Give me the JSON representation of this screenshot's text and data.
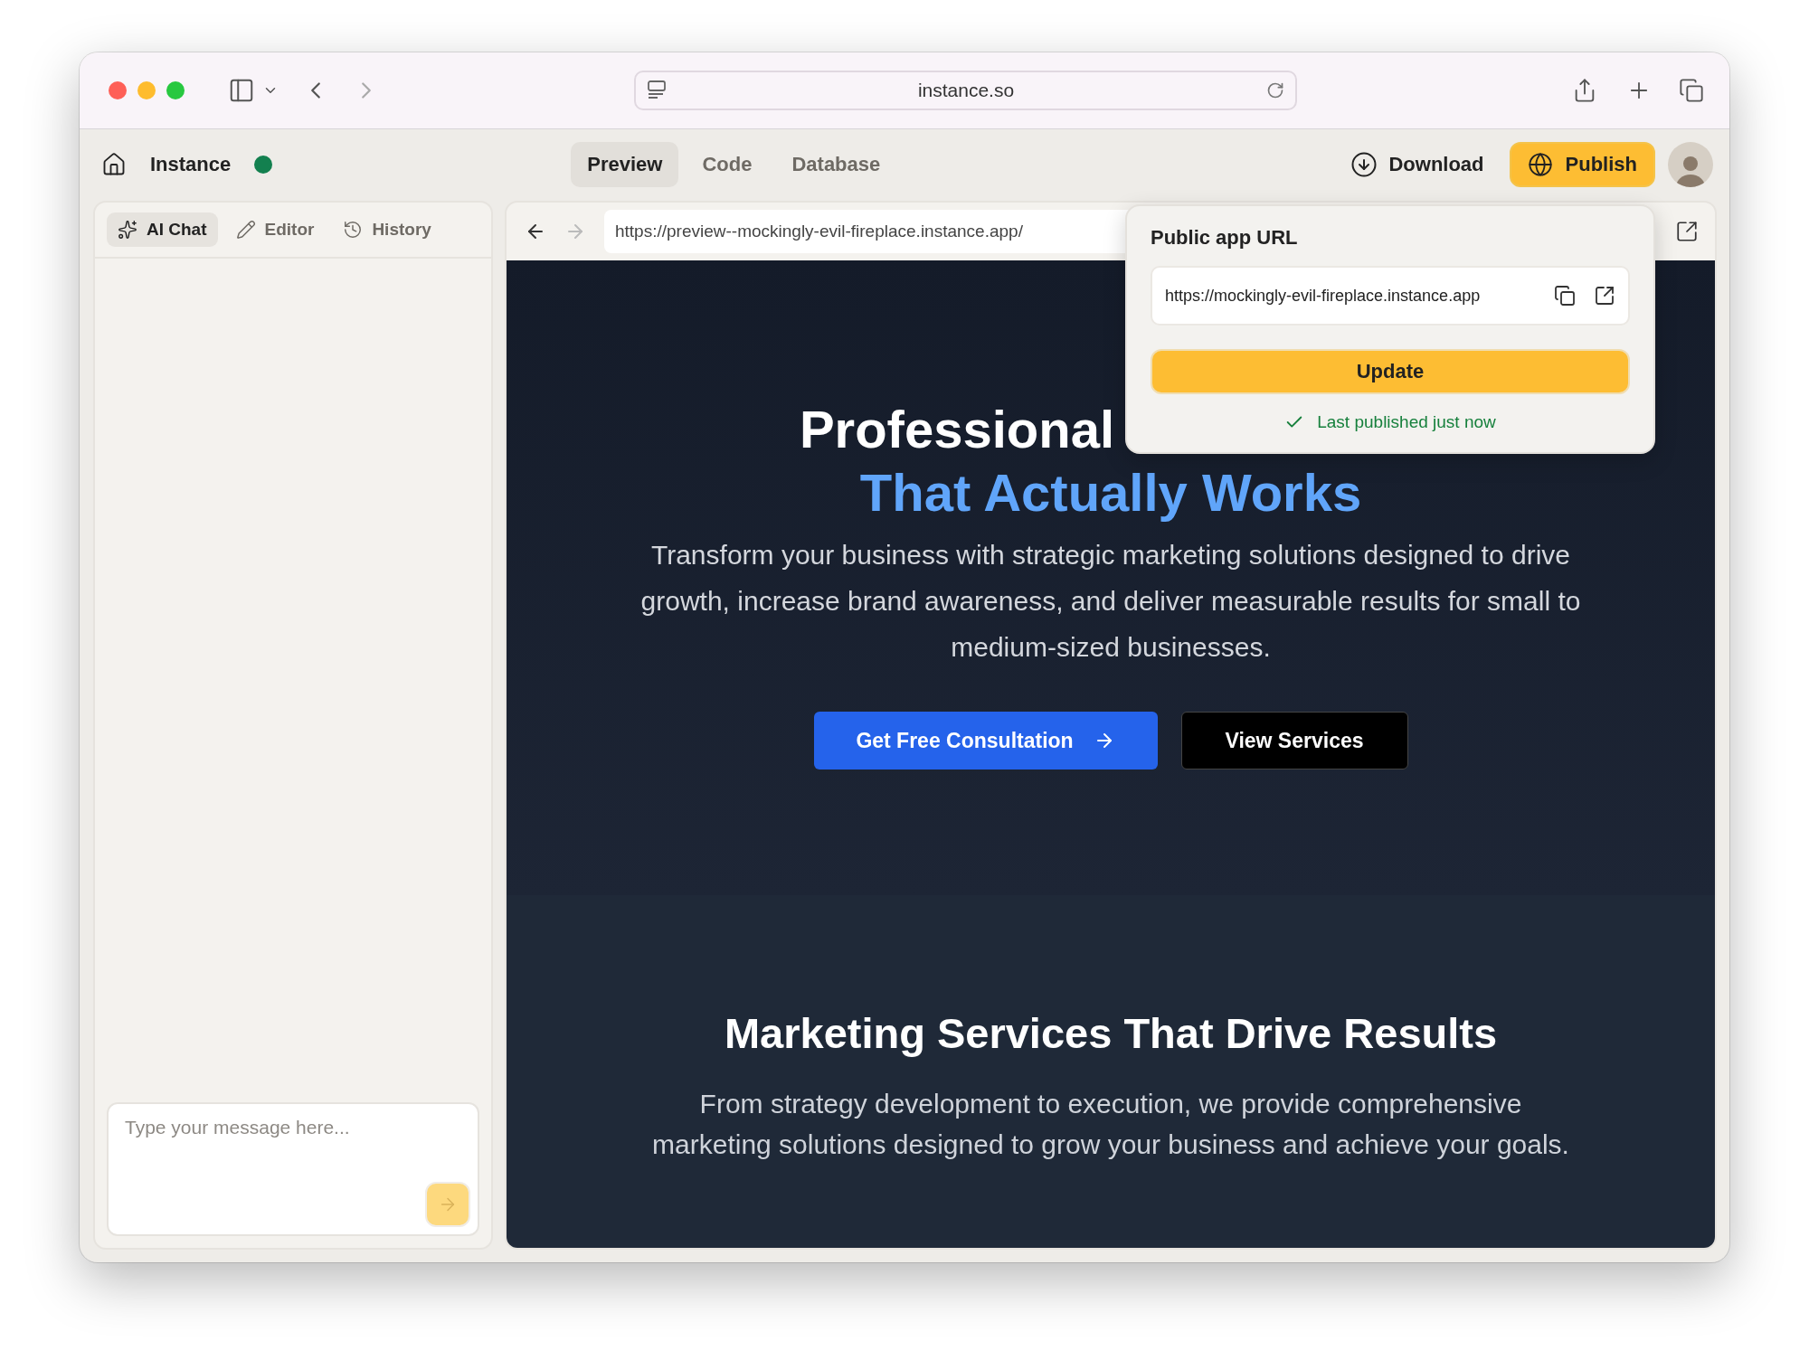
{
  "browser": {
    "address": "instance.so"
  },
  "app_bar": {
    "name": "Instance",
    "online": true,
    "tabs": [
      {
        "label": "Preview",
        "selected": true
      },
      {
        "label": "Code",
        "selected": false
      },
      {
        "label": "Database",
        "selected": false
      }
    ],
    "download": "Download",
    "publish": "Publish"
  },
  "side_panel": {
    "tabs": [
      {
        "label": "AI Chat",
        "selected": true
      },
      {
        "label": "Editor",
        "selected": false
      },
      {
        "label": "History",
        "selected": false
      }
    ],
    "chat_input": {
      "placeholder": "Type your message here..."
    }
  },
  "preview": {
    "url": "https://preview--mockingly-evil-fireplace.instance.app/",
    "hero": {
      "title_line_1": "Professional",
      "title_line_2": "That Actually Works",
      "text": "Transform your business with strategic marketing solutions designed to drive growth, increase brand awareness, and deliver measurable results for small to medium-sized businesses.",
      "primary_button": "Get Free Consultation",
      "secondary_button": "View Services"
    },
    "services": {
      "title": "Marketing Services That Drive Results",
      "text": "From strategy development to execution, we provide comprehensive marketing solutions designed to grow your business and achieve your goals."
    }
  },
  "publish_popup": {
    "title": "Public app URL",
    "url": "https://mockingly-evil-fireplace.instance.app",
    "button": "Update",
    "status": "Last published just now"
  }
}
